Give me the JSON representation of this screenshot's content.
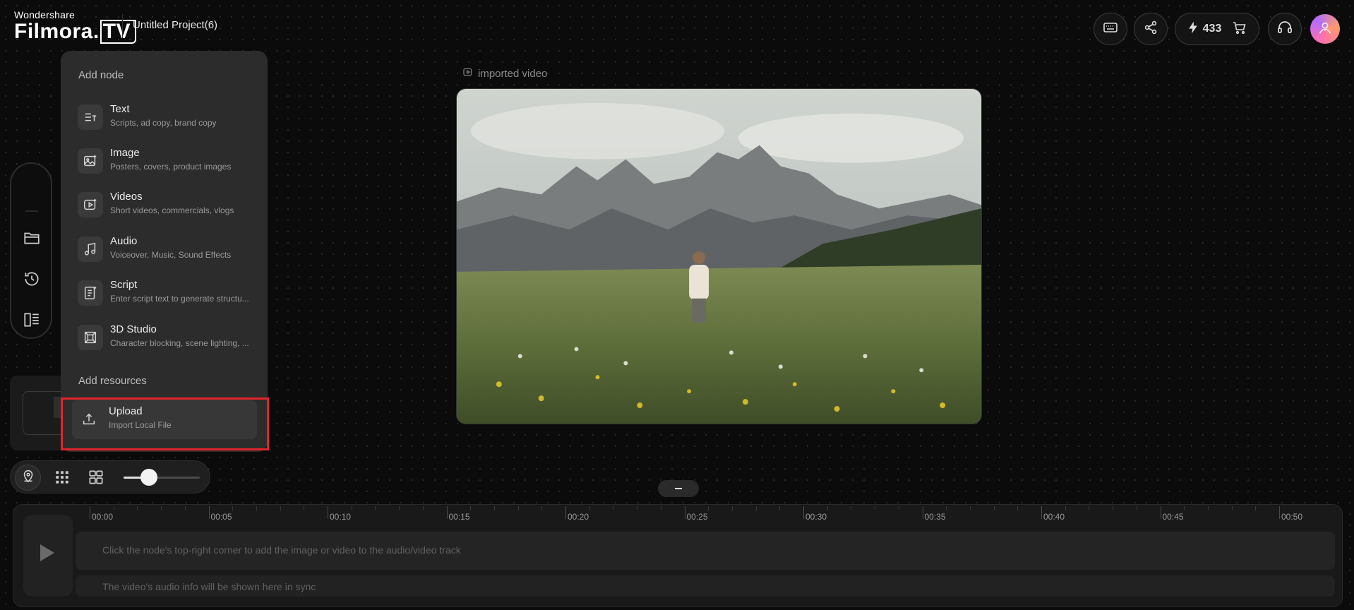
{
  "header": {
    "brand_small": "Wondershare",
    "brand_main": "Filmora.",
    "brand_tv": "TV",
    "project_title": "Untitled Project(6)",
    "credits": "433",
    "icons": [
      "keyboard-icon",
      "share-icon",
      "sparkle-icon",
      "cart-icon",
      "headset-icon",
      "user-icon"
    ]
  },
  "menu": {
    "section_nodes": "Add node",
    "items": [
      {
        "title": "Text",
        "subtitle": "Scripts, ad copy, brand copy",
        "icon": "text-icon"
      },
      {
        "title": "Image",
        "subtitle": "Posters, covers, product images",
        "icon": "image-icon"
      },
      {
        "title": "Videos",
        "subtitle": "Short videos, commercials, vlogs",
        "icon": "video-icon"
      },
      {
        "title": "Audio",
        "subtitle": "Voiceover, Music, Sound Effects",
        "icon": "music-icon"
      },
      {
        "title": "Script",
        "subtitle": "Enter script text to generate structu...",
        "icon": "script-icon"
      },
      {
        "title": "3D Studio",
        "subtitle": "Character blocking, scene lighting, ...",
        "icon": "3d-studio-icon"
      }
    ],
    "section_resources": "Add resources",
    "upload": {
      "title": "Upload",
      "subtitle": "Import Local File",
      "icon": "upload-icon"
    }
  },
  "canvas": {
    "video_label": "imported video"
  },
  "toolbar": {
    "zoom_fraction": 0.33
  },
  "timeline": {
    "ticks": [
      "00:00",
      "00:05",
      "00:10",
      "00:15",
      "00:20",
      "00:25",
      "00:30",
      "00:35",
      "00:40",
      "00:45",
      "00:50"
    ],
    "track1_hint": "Click the node's top-right corner to add the image or video to the audio/video track",
    "track2_hint": "The video's audio info will be shown here in sync"
  },
  "colors": {
    "background": "#0b0b0b",
    "panel": "#2c2c2c",
    "highlight": "#e3232c"
  }
}
